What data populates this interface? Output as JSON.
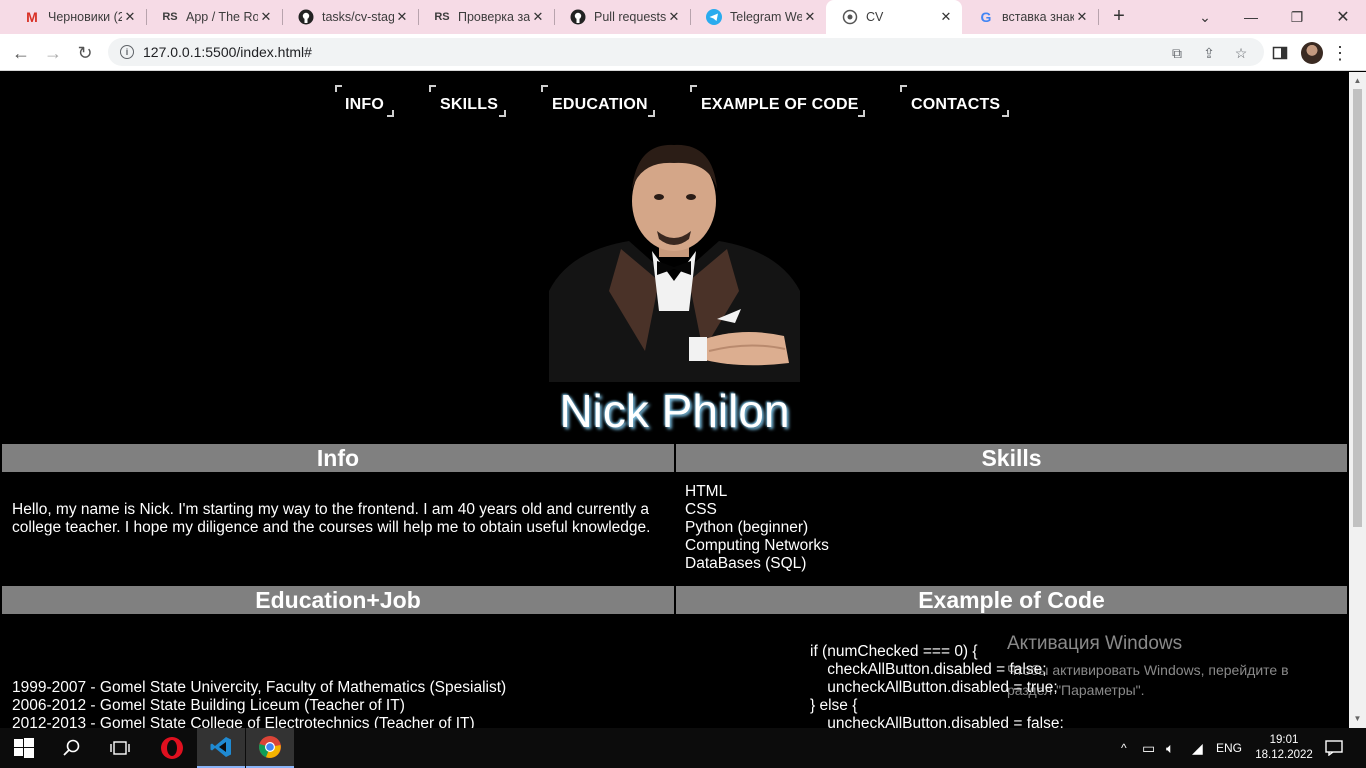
{
  "browser": {
    "tabs": [
      {
        "title": "Черновики (2",
        "icon": "gmail-icon"
      },
      {
        "title": "App / The Ro",
        "icon": "rs-school-icon"
      },
      {
        "title": "tasks/cv-stag",
        "icon": "github-icon"
      },
      {
        "title": "Проверка за",
        "icon": "rs-school-icon"
      },
      {
        "title": "Pull requests",
        "icon": "github-icon"
      },
      {
        "title": "Telegram Wel",
        "icon": "telegram-icon"
      },
      {
        "title": "CV",
        "icon": "globe-icon"
      },
      {
        "title": "вставка знак",
        "icon": "google-icon"
      }
    ],
    "active_tab": 6,
    "url": "127.0.0.1:5500/index.html#"
  },
  "page": {
    "nav": [
      "INFO",
      "SKILLS",
      "EDUCATION",
      "EXAMPLE OF CODE",
      "CONTACTS"
    ],
    "name": "Nick Philon",
    "info": {
      "heading": "Info",
      "text": "Hello, my name is Nick. I'm starting my way to the frontend. I am 40 years old and currently a college teacher. I hope my diligence and the courses will help me to obtain useful knowledge."
    },
    "skills": {
      "heading": "Skills",
      "items": [
        "HTML",
        "CSS",
        "Python (beginner)",
        "Computing Networks",
        "DataBases (SQL)"
      ]
    },
    "education": {
      "heading": "Education+Job",
      "items": [
        "1999-2007 - Gomel State Univercity, Faculty of Mathematics (Spesialist)",
        "2006-2012 - Gomel State Building Liceum (Teacher of IT)",
        "2012-2013 - Gomel State College of Electrotechnics (Teacher of IT)"
      ]
    },
    "code": {
      "heading": "Example of Code",
      "lines": [
        "if (numChecked === 0) {",
        "    checkAllButton.disabled = false;",
        "    uncheckAllButton.disabled = true;",
        "} else {",
        "    uncheckAllButton.disabled = false;"
      ]
    }
  },
  "watermark": {
    "title": "Активация Windows",
    "line1": "Чтобы активировать Windows, перейдите в",
    "line2": "раздел \"Параметры\"."
  },
  "taskbar": {
    "language": "ENG",
    "time": "19:01",
    "date": "18.12.2022"
  },
  "colors": {
    "tabstrip": "#f6dbe6",
    "page_bg": "#000000",
    "section_header": "#808080",
    "name_glow": "#7ec3e6"
  }
}
